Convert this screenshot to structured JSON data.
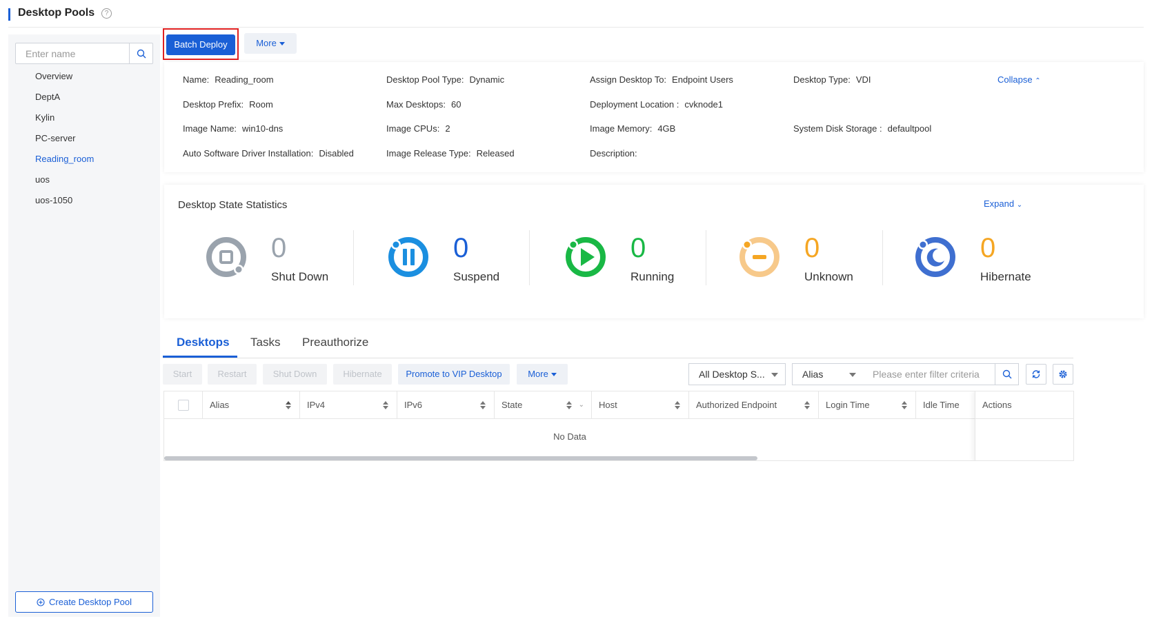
{
  "page": {
    "title": "Desktop Pools",
    "help_icon": "question-circle-icon"
  },
  "sidebar": {
    "search_placeholder": "Enter name",
    "items": [
      {
        "label": "Overview"
      },
      {
        "label": "DeptA"
      },
      {
        "label": "Kylin"
      },
      {
        "label": "PC-server"
      },
      {
        "label": "Reading_room",
        "active": true
      },
      {
        "label": "uos"
      },
      {
        "label": "uos-1050"
      }
    ],
    "create_label": "Create Desktop Pool"
  },
  "top_actions": {
    "batch_deploy": "Batch Deploy",
    "more": "More"
  },
  "info": {
    "collapse": "Collapse",
    "fields": {
      "name": {
        "k": "Name:",
        "v": "Reading_room"
      },
      "pool_type": {
        "k": "Desktop Pool Type:",
        "v": "Dynamic"
      },
      "assign_to": {
        "k": "Assign Desktop To:",
        "v": "Endpoint Users"
      },
      "desktop_type": {
        "k": "Desktop Type:",
        "v": "VDI"
      },
      "prefix": {
        "k": "Desktop Prefix:",
        "v": "Room"
      },
      "max_desktops": {
        "k": "Max Desktops:",
        "v": "60"
      },
      "deploy_location": {
        "k": "Deployment Location :",
        "v": "cvknode1"
      },
      "image_name": {
        "k": "Image Name:",
        "v": "win10-dns"
      },
      "image_cpus": {
        "k": "Image CPUs:",
        "v": "2"
      },
      "image_memory": {
        "k": "Image Memory:",
        "v": "4GB"
      },
      "sys_disk": {
        "k": "System Disk Storage :",
        "v": "defaultpool"
      },
      "auto_driver": {
        "k": "Auto Software Driver Installation:",
        "v": "Disabled"
      },
      "release_type": {
        "k": "Image Release Type:",
        "v": "Released"
      },
      "description": {
        "k": "Description:",
        "v": ""
      }
    }
  },
  "stats": {
    "title": "Desktop State Statistics",
    "expand": "Expand",
    "items": [
      {
        "label": "Shut Down",
        "value": "0",
        "color": "#9aa3ad",
        "icon": "stop-circle-icon"
      },
      {
        "label": "Suspend",
        "value": "0",
        "color": "#1b8fe0",
        "icon": "pause-circle-icon"
      },
      {
        "label": "Running",
        "value": "0",
        "color": "#19b845",
        "icon": "play-circle-icon"
      },
      {
        "label": "Unknown",
        "value": "0",
        "color": "#f5a623",
        "icon": "minus-circle-icon"
      },
      {
        "label": "Hibernate",
        "value": "0",
        "color": "#3f6fd0",
        "icon": "moon-circle-icon"
      }
    ]
  },
  "tabs": [
    {
      "label": "Desktops",
      "active": true
    },
    {
      "label": "Tasks"
    },
    {
      "label": "Preauthorize"
    }
  ],
  "toolbar": {
    "start": "Start",
    "restart": "Restart",
    "shutdown": "Shut Down",
    "hibernate": "Hibernate",
    "promote_vip": "Promote to VIP Desktop",
    "more": "More",
    "state_filter": "All Desktop S...",
    "field_select": "Alias",
    "filter_placeholder": "Please enter filter criteria"
  },
  "table": {
    "columns": [
      "Alias",
      "IPv4",
      "IPv6",
      "State",
      "Host",
      "Authorized Endpoint",
      "Login Time",
      "Idle Time",
      "Actions"
    ],
    "empty_text": "No Data"
  }
}
